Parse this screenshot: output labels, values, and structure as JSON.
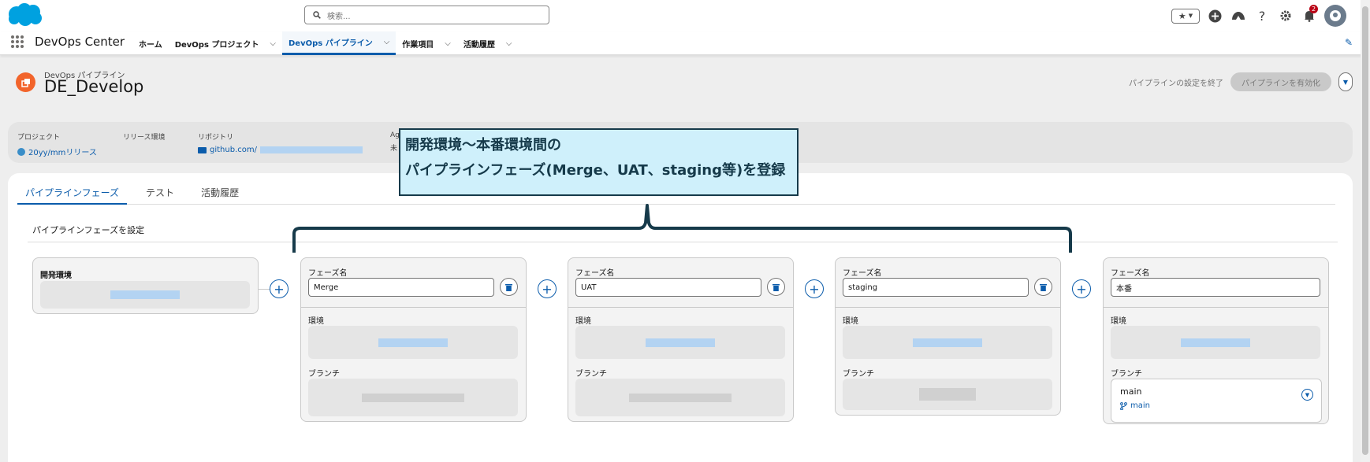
{
  "header": {
    "search_placeholder": "検索...",
    "notification_count": "2"
  },
  "nav": {
    "app_name": "DevOps Center",
    "items": [
      {
        "label": "ホーム",
        "has_menu": false
      },
      {
        "label": "DevOps プロジェクト",
        "has_menu": true
      },
      {
        "label": "DevOps パイプライン",
        "has_menu": true,
        "active": true
      },
      {
        "label": "作業項目",
        "has_menu": true
      },
      {
        "label": "活動履歴",
        "has_menu": true
      }
    ]
  },
  "page_header": {
    "object_type": "DevOps パイプライン",
    "title": "DE_Develop",
    "end_setup_label": "パイプラインの設定を終了",
    "activate_label": "パイプラインを有効化"
  },
  "highlights": {
    "project_label": "プロジェクト",
    "project_value": "20yy/mmリリース",
    "release_env_label": "リリース環境",
    "repo_label": "リポジトリ",
    "repo_value": "github.com/",
    "extra_label": "Ag",
    "extra_value": "未"
  },
  "tabs": [
    "パイプラインフェーズ",
    "テスト",
    "活動履歴"
  ],
  "section_title": "パイプラインフェーズを設定",
  "labels": {
    "stage_name": "フェーズ名",
    "environment": "環境",
    "branch": "ブランチ"
  },
  "dev_stage": {
    "title": "開発環境"
  },
  "stages": [
    {
      "name": "Merge"
    },
    {
      "name": "UAT"
    },
    {
      "name": "staging"
    },
    {
      "name": "本番",
      "branch": "main",
      "branch_link": "main"
    }
  ],
  "annotation": {
    "line1": "開発環境〜本番環境間の",
    "line2": "パイプラインフェーズ(Merge、UAT、staging等)を登録"
  },
  "colors": {
    "brand_blue": "#0b5cab",
    "salesforce_cloud": "#00a1e0",
    "pipeline_icon": "#f2642b",
    "callout_fill": "#cff0fb",
    "callout_border": "#163a4a"
  }
}
